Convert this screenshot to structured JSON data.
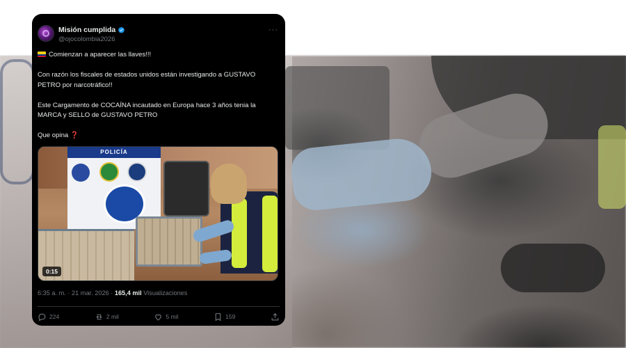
{
  "tweet": {
    "display_name": "Misión cumplida",
    "handle": "@ojocolombia2026",
    "more_icon": "more-horizontal-icon",
    "verified_icon": "verified-badge-icon",
    "text": {
      "line1": "Comienzan a aparecer las llaves!!!",
      "line2": "Con razón los fiscales de estados unidos están investigando a GUSTAVO PETRO por narcotráfico!!",
      "line3": "Este Cargamento de COCAÍNA incautado en Europa hace 3 años tenia la MARCA y SELLO de GUSTAVO PETRO",
      "line4": "Que opina",
      "line4_emoji": "❓"
    },
    "media": {
      "banner_text": "POLICÍA",
      "duration": "0:15"
    },
    "timestamp": "6:35 a. m. · 21 mar. 2026 ·",
    "views_count": "165,4 mil",
    "views_label": "Visualizaciones",
    "actions": {
      "replies": "224",
      "reposts": "2 mil",
      "likes": "5 mil",
      "bookmarks": "159"
    }
  },
  "colors": {
    "card_bg": "#000000",
    "text": "#e7e9ea",
    "muted": "#71767b",
    "verified": "#1d9bf0"
  }
}
